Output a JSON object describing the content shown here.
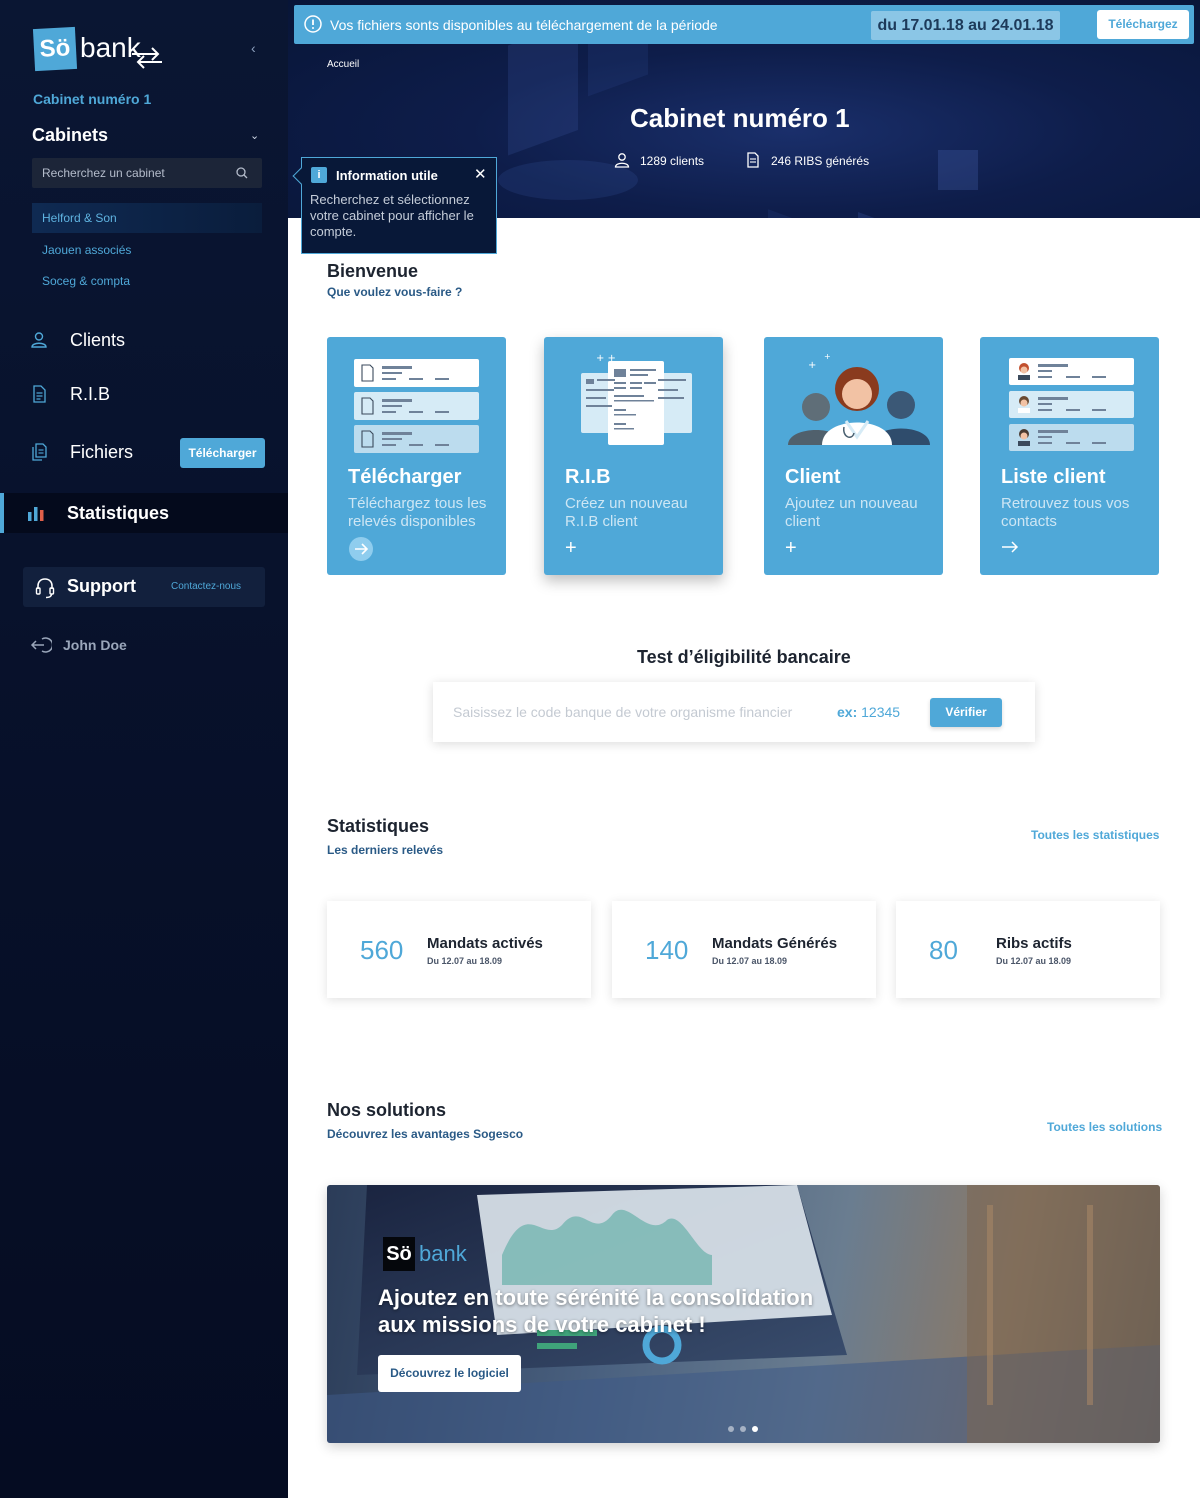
{
  "sidebar": {
    "logo_so": "Sö",
    "logo_bank": "bank",
    "current_cabinet": "Cabinet numéro 1",
    "cabinets_title": "Cabinets",
    "search_placeholder": "Recherchez un cabinet",
    "cabinets": [
      "Helford & Son",
      "Jaouen associés",
      "Soceg & compta"
    ],
    "nav": {
      "clients": "Clients",
      "rib": "R.I.B",
      "fichiers": "Fichiers",
      "fichiers_button": "Télécharger",
      "statistiques": "Statistiques"
    },
    "support": {
      "label": "Support",
      "contact": "Contactez-nous"
    },
    "user": "John Doe"
  },
  "banner": {
    "text": "Vos fichiers sonts disponibles au téléchargement de la période",
    "period": "du 17.01.18 au 24.01.18",
    "button": "Téléchargez"
  },
  "hero": {
    "breadcrumb": "Accueil",
    "title": "Cabinet numéro 1",
    "clients": "1289 clients",
    "ribs": "246 RIBS générés"
  },
  "tooltip": {
    "title": "Information utile",
    "body": "Recherchez et sélectionnez votre cabinet pour afficher le compte."
  },
  "welcome": {
    "title": "Bienvenue",
    "subtitle": "Que voulez vous-faire ?",
    "cards": [
      {
        "title": "Télécharger",
        "desc": "Téléchargez tous les relevés disponibles",
        "action": "arrow-circle-icon"
      },
      {
        "title": "R.I.B",
        "desc": "Créez un nouveau R.I.B client",
        "action": "plus-icon"
      },
      {
        "title": "Client",
        "desc": "Ajoutez un nouveau client",
        "action": "plus-icon"
      },
      {
        "title": "Liste client",
        "desc": "Retrouvez tous vos contacts",
        "action": "arrow-right-icon"
      }
    ]
  },
  "eligibility": {
    "title": "Test d’éligibilité bancaire",
    "placeholder": "Saisissez le code banque de votre organisme financier",
    "example_label": "ex:",
    "example_value": "12345",
    "button": "Vérifier"
  },
  "stats": {
    "title": "Statistiques",
    "subtitle": "Les derniers relevés",
    "link": "Toutes les statistiques",
    "cards": [
      {
        "value": "560",
        "label": "Mandats activés",
        "period": "Du 12.07 au 18.09"
      },
      {
        "value": "140",
        "label": "Mandats Générés",
        "period": "Du 12.07 au 18.09"
      },
      {
        "value": "80",
        "label": "Ribs actifs",
        "period": "Du 12.07 au 18.09"
      }
    ]
  },
  "solutions": {
    "title": "Nos solutions",
    "subtitle": "Découvrez les avantages Sogesco",
    "link": "Toutes les solutions",
    "promo_logo_so": "Sö",
    "promo_logo_bank": "bank",
    "promo_title": "Ajoutez en toute sérénité la consolidation aux missions de votre cabinet !",
    "promo_button": "Découvrez le logiciel",
    "carousel_slides": 3,
    "carousel_active": 3
  },
  "colors": {
    "accent": "#4fa8d8",
    "sidebar_bg": "#0a1633",
    "hero_bg": "#0e1d4a",
    "text_dark": "#1d2430"
  }
}
